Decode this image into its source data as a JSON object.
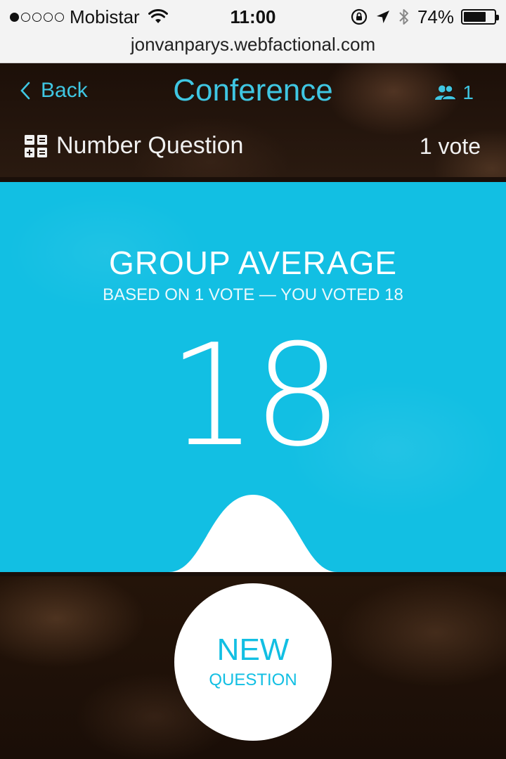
{
  "status_bar": {
    "signal_bars_filled": 1,
    "signal_bars_total": 5,
    "carrier": "Mobistar",
    "time": "11:00",
    "battery_percent": "74%",
    "battery_level": 0.74
  },
  "browser": {
    "url": "jonvanparys.webfactional.com"
  },
  "header": {
    "back_label": "Back",
    "title": "Conference",
    "participants_count": "1",
    "question_type": "Number Question",
    "vote_count": "1 vote"
  },
  "result": {
    "heading": "GROUP AVERAGE",
    "subheading": "BASED ON 1 VOTE — YOU VOTED 18",
    "value": "18"
  },
  "actions": {
    "new_question_line1": "NEW",
    "new_question_line2": "QUESTION"
  },
  "colors": {
    "accent": "#12bfe3",
    "link": "#3fc6e2"
  }
}
